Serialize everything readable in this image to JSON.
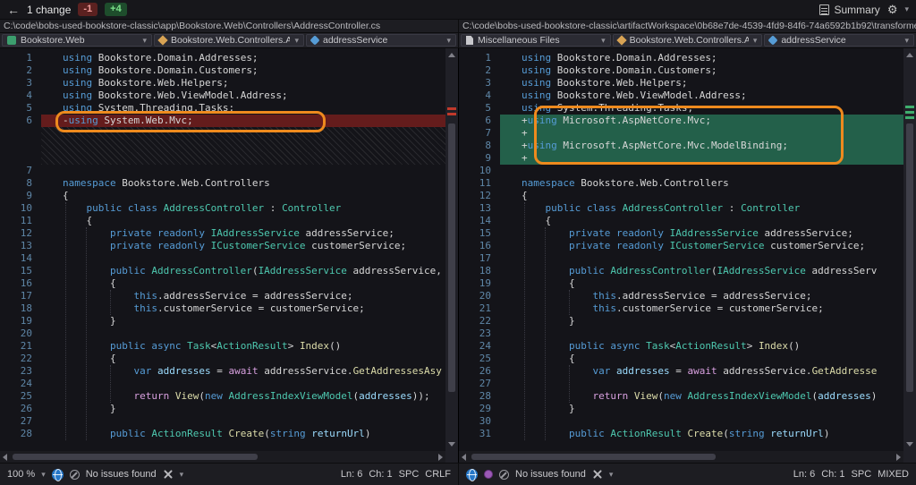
{
  "topbar": {
    "back": "←",
    "changes": "1 change",
    "removed_badge": "-1",
    "added_badge": "+4",
    "summary": "Summary",
    "gear": "⚙",
    "caret": "▾"
  },
  "panes": {
    "left": {
      "path": "C:\\code\\bobs-used-bookstore-classic\\app\\Bookstore.Web\\Controllers\\AddressController.cs",
      "nav": [
        {
          "icon": "project-icon",
          "label": "Bookstore.Web"
        },
        {
          "icon": "class-icon",
          "label": "Bookstore.Web.Controllers.Ac"
        },
        {
          "icon": "field-icon",
          "label": "addressService"
        }
      ],
      "lines": [
        {
          "n": "1",
          "type": "code",
          "s": [
            [
              "k",
              "using "
            ],
            [
              "d",
              "Bookstore.Domain.Addresses;"
            ]
          ]
        },
        {
          "n": "2",
          "type": "code",
          "s": [
            [
              "k",
              "using "
            ],
            [
              "d",
              "Bookstore.Domain.Customers;"
            ]
          ]
        },
        {
          "n": "3",
          "type": "code",
          "s": [
            [
              "k",
              "using "
            ],
            [
              "d",
              "Bookstore.Web.Helpers;"
            ]
          ]
        },
        {
          "n": "4",
          "type": "code",
          "s": [
            [
              "k",
              "using "
            ],
            [
              "d",
              "Bookstore.Web.ViewModel.Address;"
            ]
          ]
        },
        {
          "n": "5",
          "type": "code",
          "s": [
            [
              "k",
              "using "
            ],
            [
              "d",
              "System.Threading.Tasks;"
            ]
          ]
        },
        {
          "n": "6",
          "type": "removed",
          "s": [
            [
              "d",
              "-"
            ],
            [
              "k",
              "using "
            ],
            [
              "d",
              "System.Web.Mvc;"
            ]
          ]
        },
        {
          "type": "spacer"
        },
        {
          "type": "spacer"
        },
        {
          "type": "spacer"
        },
        {
          "n": "7",
          "type": "code",
          "s": []
        },
        {
          "n": "8",
          "type": "code",
          "s": [
            [
              "k",
              "namespace "
            ],
            [
              "d",
              "Bookstore.Web.Controllers"
            ]
          ]
        },
        {
          "n": "9",
          "type": "code",
          "s": [
            [
              "d",
              "{"
            ]
          ]
        },
        {
          "n": "10",
          "type": "code",
          "s": [
            [
              "d",
              "    "
            ],
            [
              "k",
              "public class "
            ],
            [
              "t",
              "AddressController"
            ],
            [
              "d",
              " : "
            ],
            [
              "t",
              "Controller"
            ]
          ]
        },
        {
          "n": "11",
          "type": "code",
          "s": [
            [
              "d",
              "    {"
            ]
          ]
        },
        {
          "n": "12",
          "type": "code",
          "s": [
            [
              "d",
              "        "
            ],
            [
              "k",
              "private readonly "
            ],
            [
              "t",
              "IAddressService"
            ],
            [
              "d",
              " addressService;"
            ]
          ]
        },
        {
          "n": "13",
          "type": "code",
          "s": [
            [
              "d",
              "        "
            ],
            [
              "k",
              "private readonly "
            ],
            [
              "t",
              "ICustomerService"
            ],
            [
              "d",
              " customerService;"
            ]
          ]
        },
        {
          "n": "14",
          "type": "code",
          "s": []
        },
        {
          "n": "15",
          "type": "code",
          "s": [
            [
              "d",
              "        "
            ],
            [
              "k",
              "public "
            ],
            [
              "t",
              "AddressController"
            ],
            [
              "d",
              "("
            ],
            [
              "t",
              "IAddressService"
            ],
            [
              "d",
              " addressService,"
            ]
          ]
        },
        {
          "n": "16",
          "type": "code",
          "s": [
            [
              "d",
              "        {"
            ]
          ]
        },
        {
          "n": "17",
          "type": "code",
          "s": [
            [
              "d",
              "            "
            ],
            [
              "k",
              "this"
            ],
            [
              "d",
              ".addressService = addressService;"
            ]
          ]
        },
        {
          "n": "18",
          "type": "code",
          "s": [
            [
              "d",
              "            "
            ],
            [
              "k",
              "this"
            ],
            [
              "d",
              ".customerService = customerService;"
            ]
          ]
        },
        {
          "n": "19",
          "type": "code",
          "s": [
            [
              "d",
              "        }"
            ]
          ]
        },
        {
          "n": "20",
          "type": "code",
          "s": []
        },
        {
          "n": "21",
          "type": "code",
          "s": [
            [
              "d",
              "        "
            ],
            [
              "k",
              "public async "
            ],
            [
              "t",
              "Task"
            ],
            [
              "d",
              "<"
            ],
            [
              "t",
              "ActionResult"
            ],
            [
              "d",
              "> "
            ],
            [
              "m",
              "Index"
            ],
            [
              "d",
              "()"
            ]
          ]
        },
        {
          "n": "22",
          "type": "code",
          "s": [
            [
              "d",
              "        {"
            ]
          ]
        },
        {
          "n": "23",
          "type": "code",
          "s": [
            [
              "d",
              "            "
            ],
            [
              "k",
              "var"
            ],
            [
              "d",
              " "
            ],
            [
              "v",
              "addresses"
            ],
            [
              "d",
              " = "
            ],
            [
              "c",
              "await"
            ],
            [
              "d",
              " addressService."
            ],
            [
              "m",
              "GetAddressesAsy"
            ]
          ]
        },
        {
          "n": "24",
          "type": "code",
          "s": []
        },
        {
          "n": "25",
          "type": "code",
          "s": [
            [
              "d",
              "            "
            ],
            [
              "c",
              "return "
            ],
            [
              "m",
              "View"
            ],
            [
              "d",
              "("
            ],
            [
              "k",
              "new "
            ],
            [
              "t",
              "AddressIndexViewModel"
            ],
            [
              "d",
              "("
            ],
            [
              "v",
              "addresses"
            ],
            [
              "d",
              "));"
            ]
          ]
        },
        {
          "n": "26",
          "type": "code",
          "s": [
            [
              "d",
              "        }"
            ]
          ]
        },
        {
          "n": "27",
          "type": "code",
          "s": []
        },
        {
          "n": "28",
          "type": "code",
          "s": [
            [
              "d",
              "        "
            ],
            [
              "k",
              "public "
            ],
            [
              "t",
              "ActionResult"
            ],
            [
              "d",
              " "
            ],
            [
              "m",
              "Create"
            ],
            [
              "d",
              "("
            ],
            [
              "k",
              "string"
            ],
            [
              "d",
              " "
            ],
            [
              "v",
              "returnUrl"
            ],
            [
              "d",
              ")"
            ]
          ]
        }
      ]
    },
    "right": {
      "path": "C:\\code\\bobs-used-bookstore-classic\\artifactWorkspace\\0b68e7de-4539-4fd9-84f6-74a6592b1b92\\transformedC",
      "nav": [
        {
          "icon": "file-icon",
          "label": "Miscellaneous Files"
        },
        {
          "icon": "class-icon",
          "label": "Bookstore.Web.Controllers.Ac"
        },
        {
          "icon": "field-icon",
          "label": "addressService"
        }
      ],
      "lines": [
        {
          "n": "1",
          "type": "code",
          "s": [
            [
              "k",
              "using "
            ],
            [
              "d",
              "Bookstore.Domain.Addresses;"
            ]
          ]
        },
        {
          "n": "2",
          "type": "code",
          "s": [
            [
              "k",
              "using "
            ],
            [
              "d",
              "Bookstore.Domain.Customers;"
            ]
          ]
        },
        {
          "n": "3",
          "type": "code",
          "s": [
            [
              "k",
              "using "
            ],
            [
              "d",
              "Bookstore.Web.Helpers;"
            ]
          ]
        },
        {
          "n": "4",
          "type": "code",
          "s": [
            [
              "k",
              "using "
            ],
            [
              "d",
              "Bookstore.Web.ViewModel.Address;"
            ]
          ]
        },
        {
          "n": "5",
          "type": "code",
          "s": [
            [
              "k",
              "using "
            ],
            [
              "d",
              "System.Threading.Tasks;"
            ]
          ]
        },
        {
          "n": "6",
          "type": "added",
          "s": [
            [
              "d",
              "+"
            ],
            [
              "k",
              "using "
            ],
            [
              "d",
              "Microsoft.AspNetCore.Mvc;"
            ]
          ]
        },
        {
          "n": "7",
          "type": "added",
          "s": [
            [
              "d",
              "+"
            ]
          ]
        },
        {
          "n": "8",
          "type": "added",
          "s": [
            [
              "d",
              "+"
            ],
            [
              "k",
              "using "
            ],
            [
              "d",
              "Microsoft.AspNetCore.Mvc.ModelBinding;"
            ]
          ]
        },
        {
          "n": "9",
          "type": "added",
          "s": [
            [
              "d",
              "+"
            ]
          ]
        },
        {
          "n": "10",
          "type": "code",
          "s": []
        },
        {
          "n": "11",
          "type": "code",
          "s": [
            [
              "k",
              "namespace "
            ],
            [
              "d",
              "Bookstore.Web.Controllers"
            ]
          ]
        },
        {
          "n": "12",
          "type": "code",
          "s": [
            [
              "d",
              "{"
            ]
          ]
        },
        {
          "n": "13",
          "type": "code",
          "s": [
            [
              "d",
              "    "
            ],
            [
              "k",
              "public class "
            ],
            [
              "t",
              "AddressController"
            ],
            [
              "d",
              " : "
            ],
            [
              "t",
              "Controller"
            ]
          ]
        },
        {
          "n": "14",
          "type": "code",
          "s": [
            [
              "d",
              "    {"
            ]
          ]
        },
        {
          "n": "15",
          "type": "code",
          "s": [
            [
              "d",
              "        "
            ],
            [
              "k",
              "private readonly "
            ],
            [
              "t",
              "IAddressService"
            ],
            [
              "d",
              " addressService;"
            ]
          ]
        },
        {
          "n": "16",
          "type": "code",
          "s": [
            [
              "d",
              "        "
            ],
            [
              "k",
              "private readonly "
            ],
            [
              "t",
              "ICustomerService"
            ],
            [
              "d",
              " customerService;"
            ]
          ]
        },
        {
          "n": "17",
          "type": "code",
          "s": []
        },
        {
          "n": "18",
          "type": "code",
          "s": [
            [
              "d",
              "        "
            ],
            [
              "k",
              "public "
            ],
            [
              "t",
              "AddressController"
            ],
            [
              "d",
              "("
            ],
            [
              "t",
              "IAddressService"
            ],
            [
              "d",
              " addressServ"
            ]
          ]
        },
        {
          "n": "19",
          "type": "code",
          "s": [
            [
              "d",
              "        {"
            ]
          ]
        },
        {
          "n": "20",
          "type": "code",
          "s": [
            [
              "d",
              "            "
            ],
            [
              "k",
              "this"
            ],
            [
              "d",
              ".addressService = addressService;"
            ]
          ]
        },
        {
          "n": "21",
          "type": "code",
          "s": [
            [
              "d",
              "            "
            ],
            [
              "k",
              "this"
            ],
            [
              "d",
              ".customerService = customerService;"
            ]
          ]
        },
        {
          "n": "22",
          "type": "code",
          "s": [
            [
              "d",
              "        }"
            ]
          ]
        },
        {
          "n": "23",
          "type": "code",
          "s": []
        },
        {
          "n": "24",
          "type": "code",
          "s": [
            [
              "d",
              "        "
            ],
            [
              "k",
              "public async "
            ],
            [
              "t",
              "Task"
            ],
            [
              "d",
              "<"
            ],
            [
              "t",
              "ActionResult"
            ],
            [
              "d",
              "> "
            ],
            [
              "m",
              "Index"
            ],
            [
              "d",
              "()"
            ]
          ]
        },
        {
          "n": "25",
          "type": "code",
          "s": [
            [
              "d",
              "        {"
            ]
          ]
        },
        {
          "n": "26",
          "type": "code",
          "s": [
            [
              "d",
              "            "
            ],
            [
              "k",
              "var"
            ],
            [
              "d",
              " "
            ],
            [
              "v",
              "addresses"
            ],
            [
              "d",
              " = "
            ],
            [
              "c",
              "await"
            ],
            [
              "d",
              " addressService."
            ],
            [
              "m",
              "GetAddresse"
            ]
          ]
        },
        {
          "n": "27",
          "type": "code",
          "s": []
        },
        {
          "n": "28",
          "type": "code",
          "s": [
            [
              "d",
              "            "
            ],
            [
              "c",
              "return "
            ],
            [
              "m",
              "View"
            ],
            [
              "d",
              "("
            ],
            [
              "k",
              "new "
            ],
            [
              "t",
              "AddressIndexViewModel"
            ],
            [
              "d",
              "("
            ],
            [
              "v",
              "addresses"
            ],
            [
              "d",
              ")"
            ]
          ]
        },
        {
          "n": "29",
          "type": "code",
          "s": [
            [
              "d",
              "        }"
            ]
          ]
        },
        {
          "n": "30",
          "type": "code",
          "s": []
        },
        {
          "n": "31",
          "type": "code",
          "s": [
            [
              "d",
              "        "
            ],
            [
              "k",
              "public "
            ],
            [
              "t",
              "ActionResult"
            ],
            [
              "d",
              " "
            ],
            [
              "m",
              "Create"
            ],
            [
              "d",
              "("
            ],
            [
              "k",
              "string"
            ],
            [
              "d",
              " "
            ],
            [
              "v",
              "returnUrl"
            ],
            [
              "d",
              ")"
            ]
          ]
        }
      ]
    }
  },
  "status": {
    "left": {
      "zoom": "100 %",
      "issues": "No issues found",
      "ln": "Ln: 6",
      "ch": "Ch: 1",
      "spc": "SPC",
      "eol": "CRLF"
    },
    "right": {
      "issues": "No issues found",
      "ln": "Ln: 6",
      "ch": "Ch: 1",
      "spc": "SPC",
      "eol": "MIXED"
    }
  },
  "colors": {
    "annotation_orange": "#ee8a1e",
    "removed_bg": "#641c1c",
    "added_bg": "#23604a",
    "keyword": "#569cd6",
    "type": "#4ec9b0",
    "method": "#dcdcaa",
    "control": "#d8a0df"
  }
}
